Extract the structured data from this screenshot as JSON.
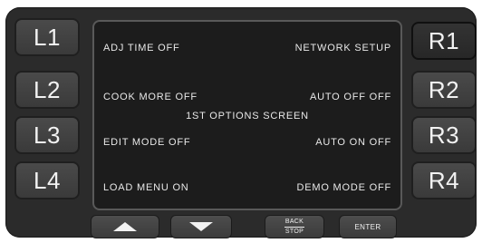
{
  "side_buttons": {
    "left": [
      "L1",
      "L2",
      "L3",
      "L4"
    ],
    "right": [
      "R1",
      "R2",
      "R3",
      "R4"
    ]
  },
  "screen": {
    "title": "1ST OPTIONS SCREEN",
    "rows": [
      {
        "left": "ADJ TIME  OFF",
        "right": "NETWORK SETUP"
      },
      {
        "left": "COOK MORE  OFF",
        "right": "AUTO OFF  OFF"
      },
      {
        "left": "EDIT MODE  OFF",
        "right": "AUTO ON  OFF"
      },
      {
        "left": "LOAD MENU  ON",
        "right": "DEMO MODE  OFF"
      }
    ]
  },
  "bottom_buttons": {
    "back_top": "BACK",
    "back_bottom": "STOP",
    "enter": "ENTER"
  }
}
